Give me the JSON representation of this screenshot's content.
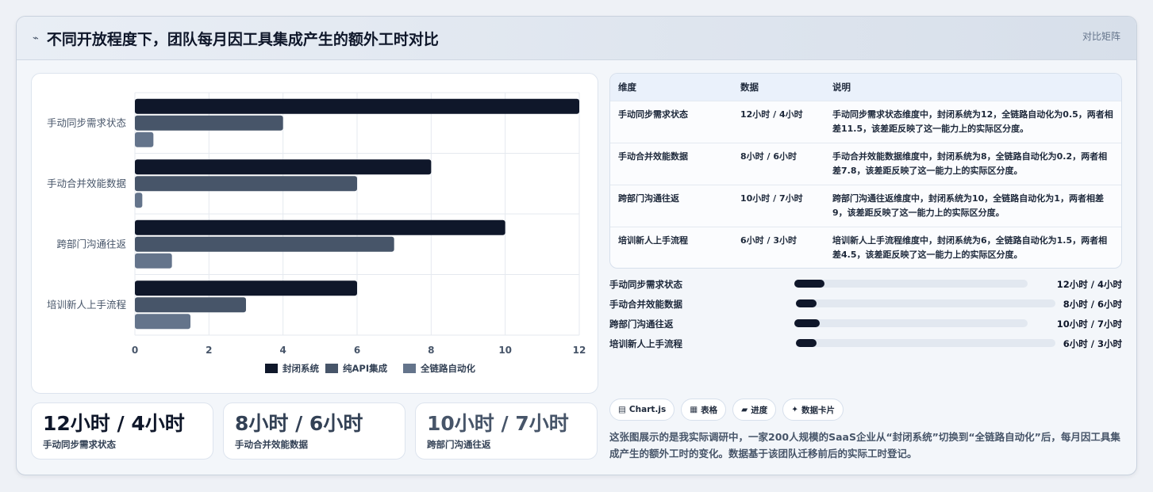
{
  "header": {
    "title": "不同开放程度下，团队每月因工具集成产生的额外工时对比",
    "tag": "对比矩阵"
  },
  "chart_data": {
    "type": "bar",
    "orientation": "horizontal",
    "categories": [
      "手动同步需求状态",
      "手动合并效能数据",
      "跨部门沟通往返",
      "培训新人上手流程"
    ],
    "series": [
      {
        "name": "封闭系统",
        "values": [
          12,
          8,
          10,
          6
        ],
        "color": "#0f172a"
      },
      {
        "name": "纯API集成",
        "values": [
          4,
          6,
          7,
          3
        ],
        "color": "#475569"
      },
      {
        "name": "全链路自动化",
        "values": [
          0.5,
          0.2,
          1,
          1.5
        ],
        "color": "#64748b"
      }
    ],
    "xlim": [
      0,
      12
    ],
    "xticks": [
      "0",
      "2",
      "4",
      "6",
      "8",
      "10",
      "12"
    ],
    "legend_position": "bottom",
    "grid": true
  },
  "table": {
    "headers": [
      "维度",
      "数据",
      "说明"
    ],
    "rows": [
      {
        "dim": "手动同步需求状态",
        "data": "12小时 / 4小时",
        "note": "手动同步需求状态维度中，封闭系统为12，全链路自动化为0.5，两者相差11.5，该差距反映了这一能力上的实际区分度。"
      },
      {
        "dim": "手动合并效能数据",
        "data": "8小时 / 6小时",
        "note": "手动合并效能数据维度中，封闭系统为8，全链路自动化为0.2，两者相差7.8，该差距反映了这一能力上的实际区分度。"
      },
      {
        "dim": "跨部门沟通往返",
        "data": "10小时 / 7小时",
        "note": "跨部门沟通往返维度中，封闭系统为10，全链路自动化为1，两者相差9，该差距反映了这一能力上的实际区分度。"
      },
      {
        "dim": "培训新人上手流程",
        "data": "6小时 / 3小时",
        "note": "培训新人上手流程维度中，封闭系统为6，全链路自动化为1.5，两者相差4.5，该差距反映了这一能力上的实际区分度。"
      }
    ]
  },
  "progress": [
    {
      "label": "手动同步需求状态",
      "value": "12小时 / 4小时",
      "fraction": 0.13
    },
    {
      "label": "手动合并效能数据",
      "value": "8小时 / 6小时",
      "fraction": 0.08
    },
    {
      "label": "跨部门沟通往返",
      "value": "10小时 / 7小时",
      "fraction": 0.11
    },
    {
      "label": "培训新人上手流程",
      "value": "6小时 / 3小时",
      "fraction": 0.08
    }
  ],
  "chips": [
    {
      "icon": "▤",
      "label": "Chart.js"
    },
    {
      "icon": "▦",
      "label": "表格"
    },
    {
      "icon": "▰",
      "label": "进度"
    },
    {
      "icon": "✦",
      "label": "数据卡片"
    }
  ],
  "description": "这张图展示的是我实际调研中，一家200人规模的SaaS企业从“封闭系统”切换到“全链路自动化”后，每月因工具集成产生的额外工时的变化。数据基于该团队迁移前后的实际工时登记。",
  "stats": [
    {
      "value": "12小时 / 4小时",
      "label": "手动同步需求状态",
      "color": "#0f172a"
    },
    {
      "value": "8小时 / 6小时",
      "label": "手动合并效能数据",
      "color": "#334155"
    },
    {
      "value": "10小时 / 7小时",
      "label": "跨部门沟通往返",
      "color": "#475569"
    }
  ]
}
